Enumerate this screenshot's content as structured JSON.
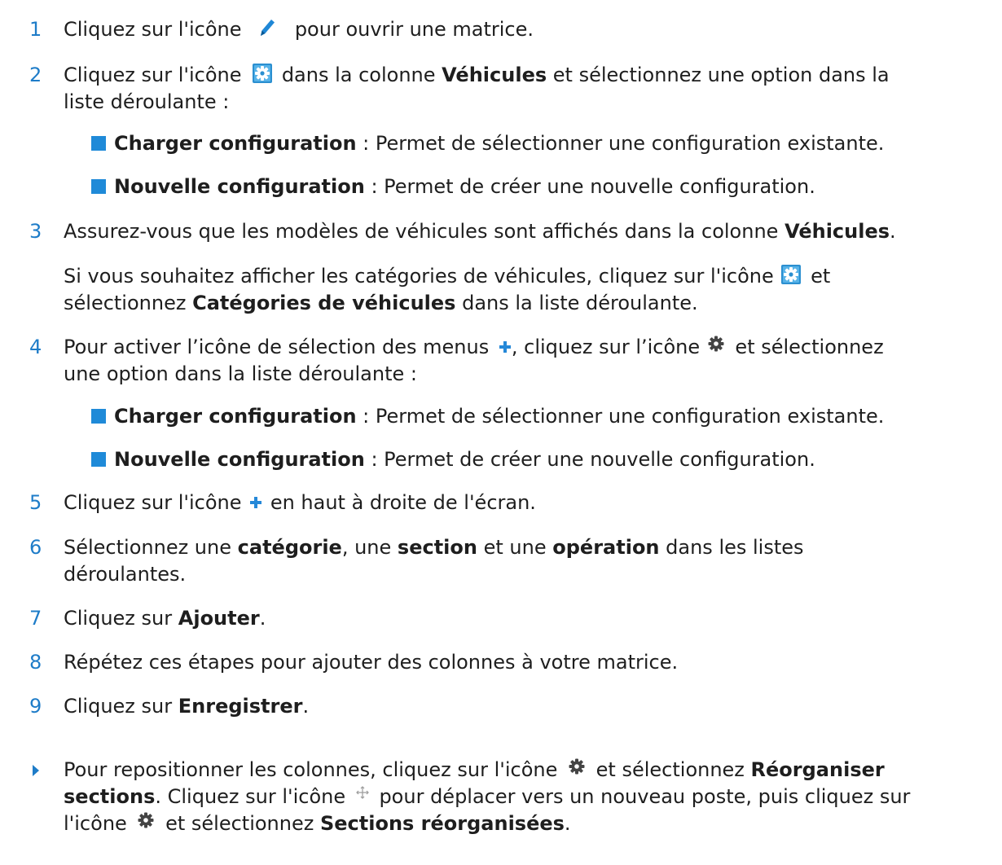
{
  "steps": {
    "s1": {
      "n": "1",
      "a": "Cliquez sur l'icône",
      "b": "pour ouvrir une matrice."
    },
    "s2": {
      "n": "2",
      "a": "Cliquez sur l'icône",
      "b": "dans la colonne",
      "c": "Véhicules",
      "d": "et sélectionnez une option dans la",
      "e": "liste déroulante :"
    },
    "s2b1": {
      "bold": "Charger configuration",
      "rest": " : Permet de sélectionner une configuration existante."
    },
    "s2b2": {
      "bold": "Nouvelle configuration",
      "rest": " : Permet de créer une nouvelle configuration."
    },
    "s3": {
      "n": "3",
      "a": "Assurez-vous que les modèles de véhicules sont affichés dans la colonne",
      "b": "Véhicules",
      "c": "."
    },
    "s3p": {
      "a": "Si vous souhaitez afficher les catégories de véhicules, cliquez sur l'icône",
      "b": "et",
      "c": "sélectionnez",
      "d": "Catégories de véhicules",
      "e": "dans la liste déroulante."
    },
    "s4": {
      "n": "4",
      "a": "Pour activer l’icône de sélection des menus",
      "b": ", cliquez sur l’icône",
      "c": "et sélectionnez",
      "d": "une option dans la liste déroulante :"
    },
    "s4b1": {
      "bold": "Charger configuration",
      "rest": " : Permet de sélectionner une configuration existante."
    },
    "s4b2": {
      "bold": "Nouvelle configuration",
      "rest": " : Permet de créer une nouvelle configuration."
    },
    "s5": {
      "n": "5",
      "a": "Cliquez sur l'icône",
      "b": "en haut à droite de l'écran."
    },
    "s6": {
      "n": "6",
      "a": "Sélectionnez une",
      "b": "catégorie",
      "c": ", une",
      "d": "section",
      "e": "et une",
      "f": "opération",
      "g": "dans les listes",
      "h": "déroulantes."
    },
    "s7": {
      "n": "7",
      "a": "Cliquez sur",
      "b": "Ajouter",
      "c": "."
    },
    "s8": {
      "n": "8",
      "a": "Répétez ces étapes pour ajouter des colonnes à votre matrice."
    },
    "s9": {
      "n": "9",
      "a": "Cliquez sur",
      "b": "Enregistrer",
      "c": "."
    }
  },
  "note": {
    "a": "Pour repositionner les colonnes, cliquez sur l'icône",
    "b": "et sélectionnez",
    "c": "Réorganiser",
    "d": "sections",
    "e": ". Cliquez sur l'icône",
    "f": "pour déplacer vers un nouveau poste, puis cliquez sur",
    "g": "l'icône",
    "h": "et sélectionnez",
    "i": "Sections réorganisées",
    "j": "."
  },
  "icons": {
    "pencil": "pencil-icon",
    "config_square": "settings-square-icon",
    "plus": "plus-icon",
    "gear": "gear-icon",
    "move": "move-icon"
  },
  "colors": {
    "accent": "#1e7cc8",
    "bullet": "#1f8ad8",
    "text": "#1e1e1e"
  }
}
